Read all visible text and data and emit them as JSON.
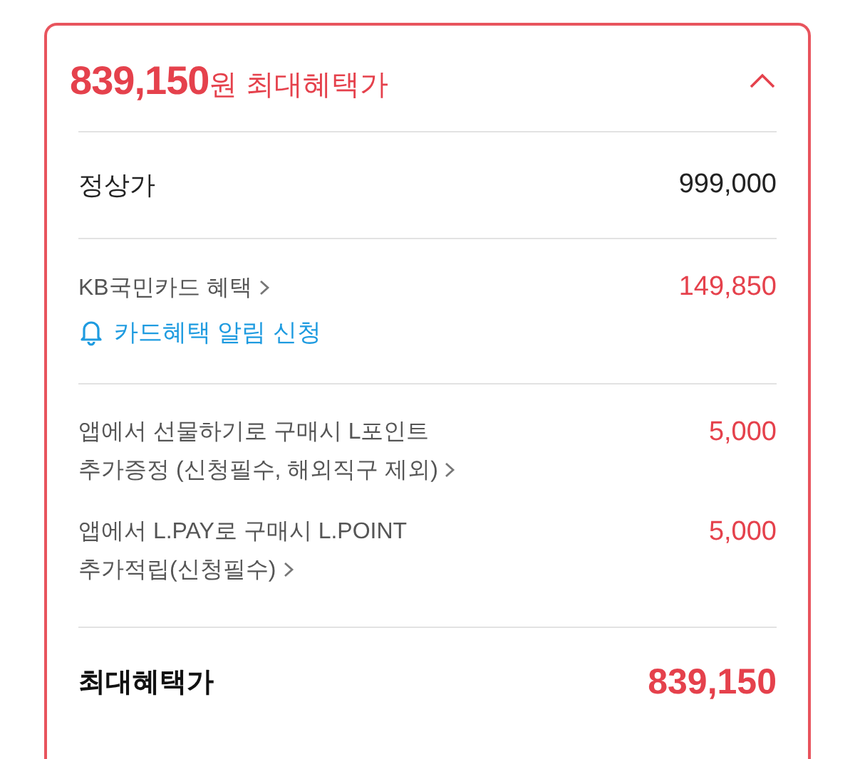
{
  "header": {
    "amount": "839,150",
    "unit": "원",
    "label": "최대혜택가",
    "expanded": true
  },
  "regular_price": {
    "label": "정상가",
    "value": "999,000"
  },
  "card_benefit": {
    "label": "KB국민카드 혜택",
    "value": "149,850",
    "alert_link": "카드혜택 알림 신청"
  },
  "benefits": [
    {
      "lines": [
        "앱에서 선물하기로 구매시 L포인트",
        "추가증정 (신청필수, 해외직구 제외)"
      ],
      "value": "5,000"
    },
    {
      "lines": [
        "앱에서 L.PAY로 구매시 L.POINT",
        "추가적립(신청필수)"
      ],
      "value": "5,000"
    }
  ],
  "total": {
    "label": "최대혜택가",
    "value": "839,150"
  }
}
